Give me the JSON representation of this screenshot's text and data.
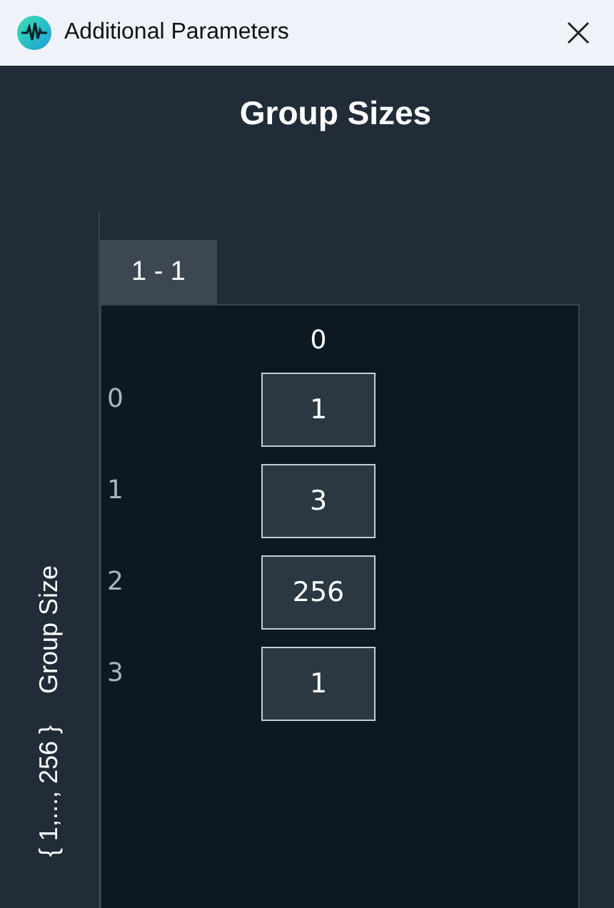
{
  "window": {
    "title": "Additional Parameters"
  },
  "heading": "Group Sizes",
  "axis_label": {
    "name": "Group Size",
    "range": "{ 1,..., 256 }"
  },
  "tabs": [
    {
      "label": "1 - 1",
      "selected": true
    }
  ],
  "table": {
    "columns": [
      "0"
    ],
    "rows": [
      {
        "label": "0",
        "value": "1"
      },
      {
        "label": "1",
        "value": "3"
      },
      {
        "label": "2",
        "value": "256"
      },
      {
        "label": "3",
        "value": "1"
      }
    ]
  }
}
